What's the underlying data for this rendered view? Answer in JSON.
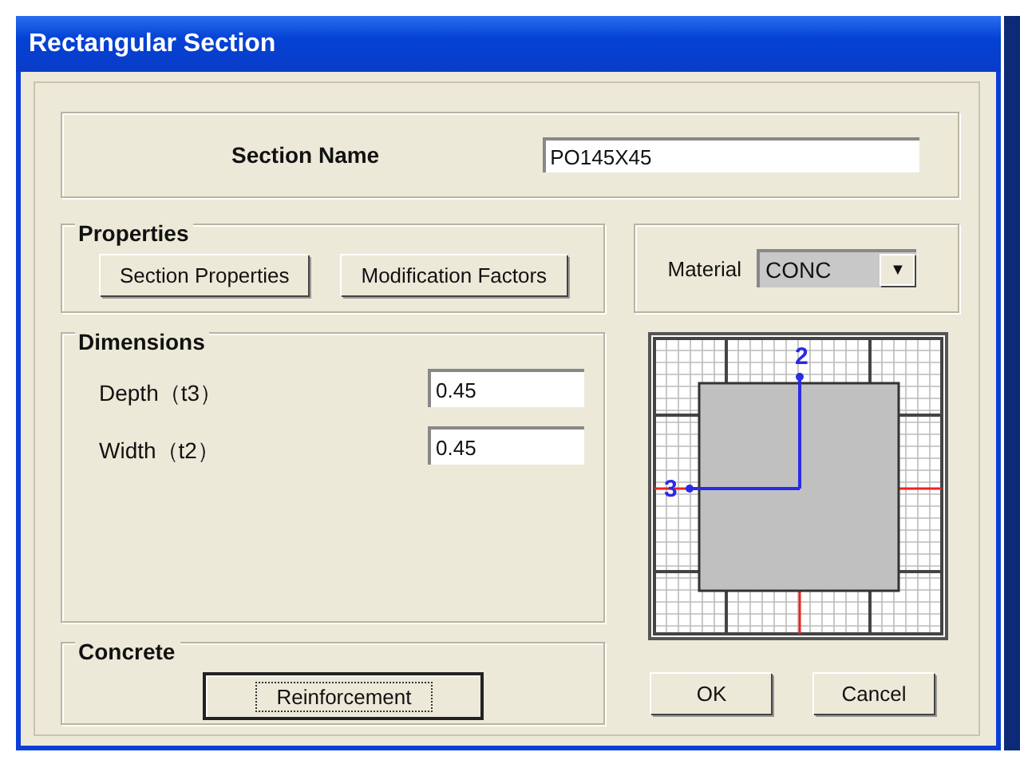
{
  "window": {
    "title": "Rectangular Section"
  },
  "section_name": {
    "label": "Section Name",
    "value": "PO145X45"
  },
  "properties": {
    "title": "Properties",
    "buttons": [
      {
        "label": "Section Properties",
        "focused": false
      },
      {
        "label": "Modification Factors",
        "focused": false
      }
    ]
  },
  "material": {
    "label": "Material",
    "value": "CONC",
    "arrow": "▼"
  },
  "dimensions": {
    "title": "Dimensions",
    "fields": [
      {
        "label": "Depth（t3）",
        "value": "0.45"
      },
      {
        "label": "Width（t2）",
        "value": "0.45"
      }
    ]
  },
  "diagram": {
    "axis_vertical": "2",
    "axis_horizontal": "3"
  },
  "concrete": {
    "title": "Concrete",
    "buttons": [
      {
        "label": "Reinforcement",
        "focused": true
      }
    ]
  },
  "buttons": [
    {
      "label": "OK",
      "focused": false
    },
    {
      "label": "Cancel",
      "focused": false
    }
  ]
}
